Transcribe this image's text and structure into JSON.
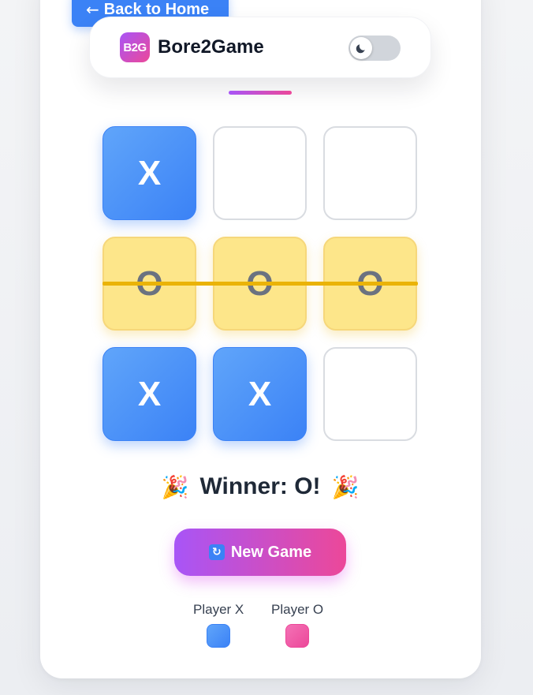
{
  "nav": {
    "back_label": "Back to Home",
    "back_icon": "arrow-left-icon"
  },
  "header": {
    "logo_text": "B2G",
    "brand": "Bore2Game",
    "theme_toggle": {
      "state": "light",
      "icon": "moon-icon"
    }
  },
  "board": {
    "cells": [
      "X",
      "",
      "",
      "O",
      "O",
      "O",
      "X",
      "X",
      ""
    ],
    "winning_line": "middle-row"
  },
  "status": {
    "emoji_left": "🎉",
    "text": "Winner: O!",
    "emoji_right": "🎉"
  },
  "new_game": {
    "icon": "🔄",
    "label": "New Game"
  },
  "legend": [
    {
      "label": "Player X",
      "color": "#3b82f6"
    },
    {
      "label": "Player O",
      "color": "#ec4899"
    }
  ],
  "colors": {
    "accent_start": "#a855f7",
    "accent_end": "#ec4899",
    "x": "#3b82f6",
    "o": "#fde68a",
    "win_line": "#eab308"
  }
}
